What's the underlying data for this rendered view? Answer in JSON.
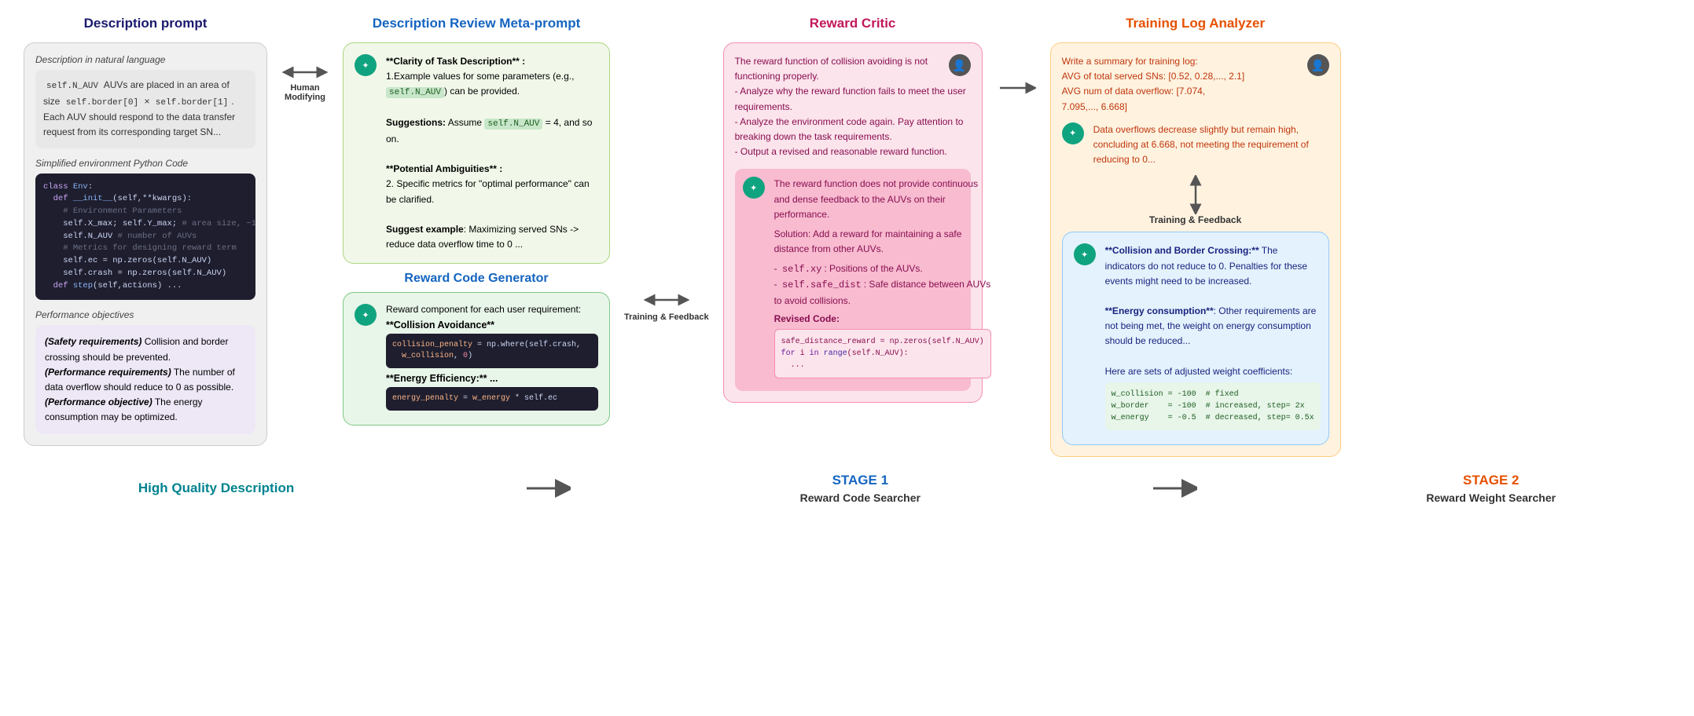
{
  "columns": {
    "description_prompt": {
      "title": "Description prompt",
      "natural_language_label": "Description in natural language",
      "natural_language_text": "`self.N_AUV` AUVs are placed in an area of size `self.border[0]` × `self.border[1]`. Each AUV should respond to the data transfer request from its corresponding target SN...",
      "python_code_label": "Simplified environment Python Code",
      "performance_objectives_label": "Performance objectives",
      "performance_text": "(Safety requirements) Collision and border crossing should be prevented.\n(Performance requirements) The number of data overflow should reduce to 0 as possible.\n(Performance objective) The energy consumption may be optimized.",
      "bottom_label": "High Quality Description"
    },
    "meta_prompt": {
      "title": "Description Review Meta-prompt",
      "card1_title": "**Clarity of Task Description** :",
      "card1_text1": "1.Example values for some parameters (e.g., `self.N_AUV`) can be provided.",
      "card1_bold": "Suggestions:",
      "card1_text2": "Assume `self.N_AUV` = 4, and so on.",
      "card1_bold2": "**Potential Ambiguities** :",
      "card1_text3": "2.  Specific metrics for \"optimal performance\" can be clarified.",
      "card1_suggest": "**Suggest example**: Maximizing served SNs -> reduce data overflow time to 0 ...",
      "card2_title": "Reward Code Generator",
      "card2_intro": "Reward component for each user requirement:",
      "card2_collision": "**Collision Avoidance**",
      "card2_energy": "**Energy Efficiency:** ..."
    },
    "reward_critic": {
      "title": "Reward Critic",
      "msg1": "The reward function of collision avoiding is not functioning properly.\n- Analyze why the reward function fails to meet the user requirements.\n- Analyze the environment code again. Pay attention to breaking down the task requirements.\n- Output a revised and reasonable reward function.",
      "msg2_intro": "The reward function does not provide continuous and dense feedback to the AUVs on their performance.",
      "msg2_solution": "Solution: Add a reward for maintaining a safe distance from other AUVs.",
      "msg2_vars": "- `self.xy`: Positions of the AUVs.\n- `self.safe_dist`: Safe distance between AUVs to avoid collisions.",
      "msg2_revised": "Revised Code:"
    },
    "training_log": {
      "title": "Training Log Analyzer",
      "msg1": "Write a summary for training log:\nAVG of total served SNs: [0.52, 0.28,..., 2.1]\nAVG num of data overflow: [7.074,\n7.095,..., 6.668]",
      "msg2": "Data overflows decrease slightly but remain high, concluding at 6.668, not meeting the requirement of reducing to 0...",
      "feedback_label": "Training & Feedback",
      "msg3_bold1": "**Collision and Border Crossing:**",
      "msg3_text1": ": The indicators do not reduce to 0. Penalties for these events might need to be increased.",
      "msg3_bold2": "**Energy consumption**",
      "msg3_text2": ": Other requirements are not being met, the weight on energy consumption should be reduced...",
      "msg3_text3": "Here are sets of adjusted weight coefficients:",
      "bottom_label": "STAGE 2",
      "bottom_sub": "Reward Weight Searcher"
    }
  },
  "arrows": {
    "double_arrow_label": "Human\nModifying",
    "right_arrow_1": "",
    "training_feedback_label": "Training &\nFeedback",
    "right_arrow_2": "",
    "stage1_label": "STAGE 1",
    "stage1_sub": "Reward Code Searcher",
    "stage2_label": "STAGE 2",
    "stage2_sub": "Reward Weight Searcher"
  },
  "colors": {
    "desc_title": "#1a1a6e",
    "meta_title": "#1565c0",
    "critic_title": "#c2185b",
    "log_title": "#e65100",
    "bottom_hq": "#00838f",
    "bottom_stage1": "#1565c0",
    "bottom_stage2": "#e65100"
  }
}
